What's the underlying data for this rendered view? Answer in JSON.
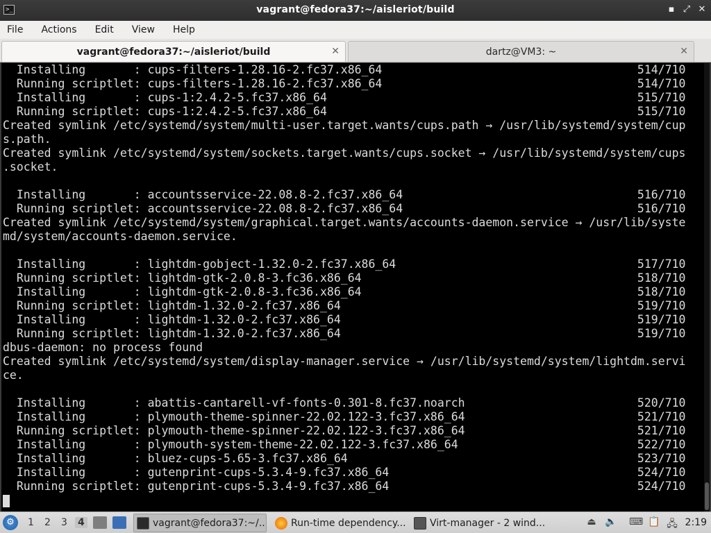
{
  "window": {
    "title": "vagrant@fedora37:~/aisleriot/build",
    "app_icon_glyph": ">_",
    "minimize_glyph": "▪",
    "maximize_glyph": "⤢",
    "close_glyph": "✕"
  },
  "menu": [
    "File",
    "Actions",
    "Edit",
    "View",
    "Help"
  ],
  "tabs": [
    {
      "label": "vagrant@fedora37:~/aisleriot/build",
      "active": true,
      "close": "✕"
    },
    {
      "label": "dartz@VM3: ~",
      "active": false,
      "close": "✕"
    }
  ],
  "terminal": {
    "lines": [
      "  Installing       : cups-filters-1.28.16-2.fc37.x86_64                                     514/710",
      "  Running scriptlet: cups-filters-1.28.16-2.fc37.x86_64                                     514/710",
      "  Installing       : cups-1:2.4.2-5.fc37.x86_64                                             515/710",
      "  Running scriptlet: cups-1:2.4.2-5.fc37.x86_64                                             515/710",
      "Created symlink /etc/systemd/system/multi-user.target.wants/cups.path → /usr/lib/systemd/system/cup",
      "s.path.",
      "Created symlink /etc/systemd/system/sockets.target.wants/cups.socket → /usr/lib/systemd/system/cups",
      ".socket.",
      "",
      "  Installing       : accountsservice-22.08.8-2.fc37.x86_64                                  516/710",
      "  Running scriptlet: accountsservice-22.08.8-2.fc37.x86_64                                  516/710",
      "Created symlink /etc/systemd/system/graphical.target.wants/accounts-daemon.service → /usr/lib/syste",
      "md/system/accounts-daemon.service.",
      "",
      "  Installing       : lightdm-gobject-1.32.0-2.fc37.x86_64                                   517/710",
      "  Running scriptlet: lightdm-gtk-2.0.8-3.fc36.x86_64                                        518/710",
      "  Installing       : lightdm-gtk-2.0.8-3.fc36.x86_64                                        518/710",
      "  Running scriptlet: lightdm-1.32.0-2.fc37.x86_64                                           519/710",
      "  Installing       : lightdm-1.32.0-2.fc37.x86_64                                           519/710",
      "  Running scriptlet: lightdm-1.32.0-2.fc37.x86_64                                           519/710",
      "dbus-daemon: no process found",
      "Created symlink /etc/systemd/system/display-manager.service → /usr/lib/systemd/system/lightdm.servi",
      "ce.",
      "",
      "  Installing       : abattis-cantarell-vf-fonts-0.301-8.fc37.noarch                         520/710",
      "  Installing       : plymouth-theme-spinner-22.02.122-3.fc37.x86_64                         521/710",
      "  Running scriptlet: plymouth-theme-spinner-22.02.122-3.fc37.x86_64                         521/710",
      "  Installing       : plymouth-system-theme-22.02.122-3.fc37.x86_64                          522/710",
      "  Installing       : bluez-cups-5.65-3.fc37.x86_64                                          523/710",
      "  Installing       : gutenprint-cups-5.3.4-9.fc37.x86_64                                    524/710",
      "  Running scriptlet: gutenprint-cups-5.3.4-9.fc37.x86_64                                    524/710"
    ]
  },
  "taskbar": {
    "start_glyph": "⚙",
    "workspaces": [
      "1",
      "2",
      "3",
      "4"
    ],
    "current_workspace": "4",
    "tasks": [
      {
        "label": "vagrant@fedora37:~/...",
        "icon": "terminal-icon",
        "active": true
      },
      {
        "label": "Run-time dependency...",
        "icon": "firefox-icon",
        "active": false
      },
      {
        "label": "Virt-manager - 2 wind...",
        "icon": "virt-manager-icon",
        "active": false
      }
    ],
    "clock": "2:19",
    "colors": {
      "start": "#2f6fb8",
      "firefox": "#e66000",
      "terminal": "#2b2b2b",
      "folder": "#8a8a8a",
      "monitor": "#3b6fb5"
    }
  }
}
